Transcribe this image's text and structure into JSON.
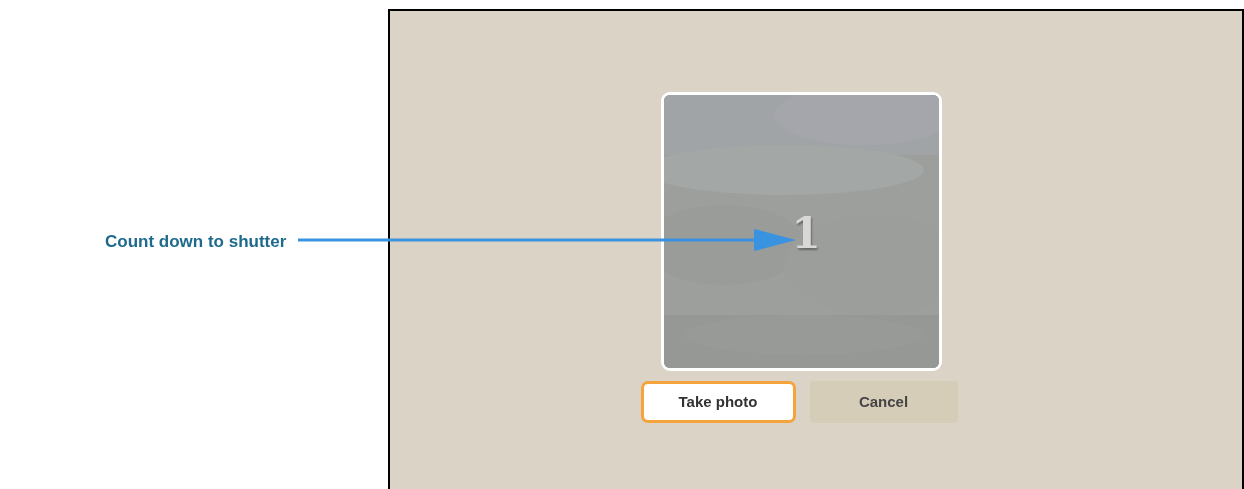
{
  "annotation": {
    "label": "Count down to shutter"
  },
  "camera_preview": {
    "countdown": "1"
  },
  "buttons": [
    {
      "label": "Take photo",
      "focused": true
    },
    {
      "label": "Cancel",
      "focused": false
    }
  ]
}
